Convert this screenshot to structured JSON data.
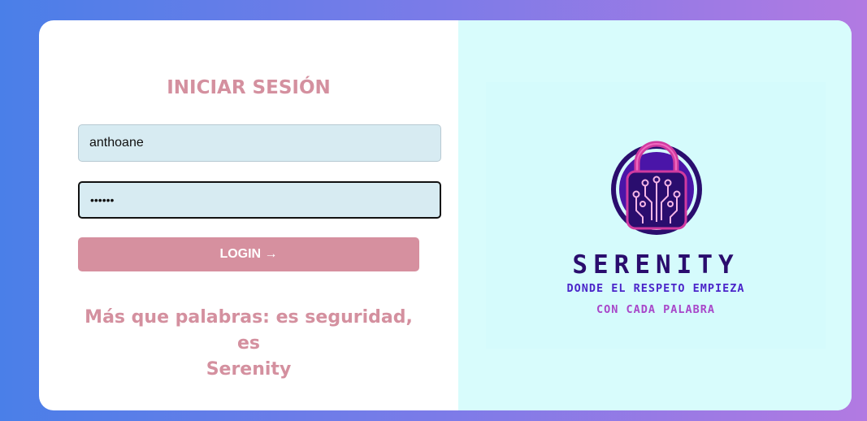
{
  "login": {
    "title": "INICIAR SESIÓN",
    "username_value": "anthoane",
    "password_value": "••••••",
    "button_label": "LOGIN →",
    "tagline_line1": "Más que palabras: es seguridad, es",
    "tagline_line2": "Serenity"
  },
  "brand": {
    "name": "SERENITY",
    "slogan_line1": "DONDE EL RESPETO EMPIEZA",
    "slogan_line2": "CON CADA PALABRA",
    "logo_icon": "circuit-padlock-icon"
  },
  "colors": {
    "background_start": "#4a7fe8",
    "background_end": "#b27ae2",
    "accent_pink": "#d6909f",
    "input_bg": "#d7ebf2",
    "brand_panel": "#d8fcfc",
    "brand_dark": "#2a0d6e",
    "brand_purple": "#4b25c9",
    "brand_magenta": "#d03aa0"
  }
}
